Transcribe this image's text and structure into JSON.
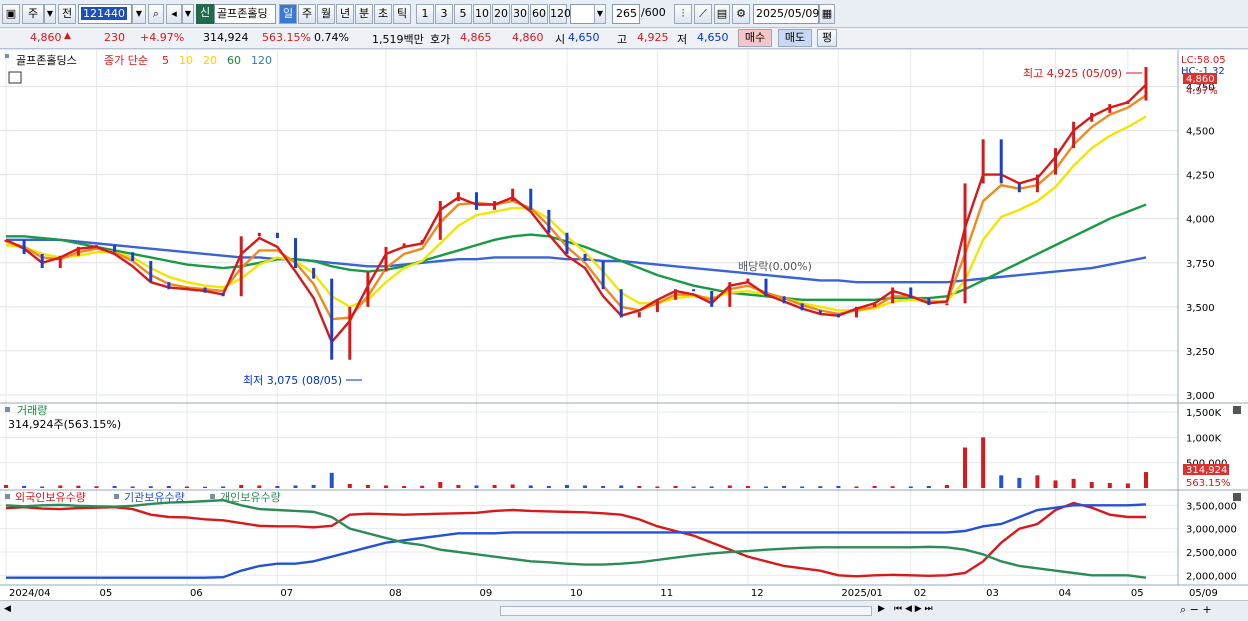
{
  "toolbar": {
    "market_label": "주",
    "prev_label": "전",
    "code": "121440",
    "new_badge": "신",
    "stock_name": "골프존홀딩",
    "periods": [
      "일",
      "주",
      "월",
      "년",
      "분",
      "초",
      "틱"
    ],
    "active_period": "일",
    "intervals": [
      "1",
      "3",
      "5",
      "10",
      "20",
      "30",
      "60",
      "120"
    ],
    "count": "265",
    "count_total": "/600",
    "date": "2025/05/09"
  },
  "quote": {
    "price": "4,860",
    "change": "230",
    "change_pct": "+4.97%",
    "volume": "314,924",
    "volume_ratio": "563.15%",
    "turnover_pct": "0.74%",
    "amount": "1,519백만",
    "bid_label": "호가",
    "bid": "4,865",
    "ask": "4,860",
    "open_label": "시",
    "open": "4,650",
    "high_label": "고",
    "high": "4,925",
    "low_label": "저",
    "low": "4,650",
    "buy_label": "매수",
    "sell_label": "매도",
    "avg_label": "평"
  },
  "legend": {
    "name": "골프존홀딩스",
    "ma_label": "종가 단순",
    "ma_periods": [
      {
        "label": "5",
        "color": "#d7191c"
      },
      {
        "label": "10",
        "color": "#f5d300"
      },
      {
        "label": "20",
        "color": "#f5d300"
      },
      {
        "label": "60",
        "color": "#1a8a3a"
      },
      {
        "label": "120",
        "color": "#2c7fb8"
      }
    ]
  },
  "annotations": {
    "high": "최고 4,925 (05/09)",
    "low": "최저 3,075 (08/05)",
    "dividend": "배당락(0.00%)",
    "lc": "LC:58.05",
    "hc": "HC:-1.32",
    "price_tag": "4,860",
    "pct_tag": "4.97%",
    "vol_tag": "314,924",
    "vol_pct_tag": "563.15%"
  },
  "volume_panel": {
    "title": "거래량",
    "value": "314,924주(563.15%)"
  },
  "holdings_panel": {
    "series": [
      "외국인보유수량",
      "기관보유수량",
      "개인보유수량"
    ]
  },
  "chart_data": {
    "type": "line",
    "title": "",
    "price_axis": {
      "ticks": [
        "4,750",
        "4,500",
        "4,250",
        "4,000",
        "3,750",
        "3,500",
        "3,250",
        "3,000"
      ],
      "ylim": [
        3000,
        4900
      ]
    },
    "volume_axis": {
      "ticks": [
        "1,500K",
        "1,000K",
        "500,000"
      ],
      "ylim": [
        0,
        1600000
      ]
    },
    "holdings_axis": {
      "ticks": [
        "3,500,000",
        "3,000,000",
        "2,500,000",
        "2,000,000"
      ],
      "ylim": [
        1900000,
        3700000
      ]
    },
    "x_labels": [
      "2024/04",
      "05",
      "06",
      "07",
      "08",
      "09",
      "10",
      "11",
      "12",
      "2025/01",
      "02",
      "03",
      "04",
      "05",
      "05/09"
    ],
    "price_close": [
      3880,
      3800,
      3720,
      3790,
      3840,
      3850,
      3810,
      3760,
      3640,
      3600,
      3610,
      3580,
      3560,
      3900,
      3920,
      3890,
      3720,
      3660,
      3200,
      3500,
      3700,
      3840,
      3860,
      3880,
      4100,
      4150,
      4050,
      4100,
      4170,
      4050,
      3920,
      3800,
      3760,
      3600,
      3440,
      3470,
      3540,
      3600,
      3590,
      3500,
      3640,
      3660,
      3560,
      3520,
      3480,
      3460,
      3440,
      3500,
      3520,
      3610,
      3550,
      3510,
      3520,
      4200,
      4450,
      4200,
      4150,
      4250,
      4400,
      4550,
      4600,
      4650,
      4670,
      4860
    ],
    "ma5": [
      3880,
      3830,
      3750,
      3780,
      3830,
      3840,
      3800,
      3730,
      3640,
      3610,
      3600,
      3590,
      3570,
      3800,
      3890,
      3840,
      3700,
      3550,
      3300,
      3420,
      3620,
      3800,
      3840,
      3860,
      4050,
      4120,
      4080,
      4080,
      4120,
      4040,
      3910,
      3790,
      3720,
      3560,
      3450,
      3480,
      3540,
      3590,
      3570,
      3520,
      3620,
      3640,
      3570,
      3530,
      3490,
      3460,
      3450,
      3490,
      3520,
      3590,
      3560,
      3520,
      3530,
      3950,
      4250,
      4250,
      4200,
      4230,
      4350,
      4500,
      4580,
      4630,
      4660,
      4760
    ],
    "ma10": [
      3870,
      3840,
      3780,
      3770,
      3810,
      3830,
      3810,
      3760,
      3680,
      3630,
      3610,
      3600,
      3590,
      3720,
      3820,
      3820,
      3750,
      3630,
      3430,
      3440,
      3560,
      3720,
      3800,
      3830,
      3980,
      4080,
      4090,
      4080,
      4100,
      4060,
      3960,
      3840,
      3750,
      3620,
      3500,
      3480,
      3520,
      3570,
      3570,
      3540,
      3600,
      3620,
      3580,
      3550,
      3510,
      3480,
      3460,
      3480,
      3500,
      3560,
      3560,
      3530,
      3530,
      3800,
      4100,
      4190,
      4170,
      4190,
      4280,
      4420,
      4520,
      4590,
      4630,
      4700
    ],
    "ma20": [
      3850,
      3840,
      3800,
      3780,
      3790,
      3810,
      3810,
      3780,
      3720,
      3670,
      3640,
      3620,
      3610,
      3660,
      3740,
      3780,
      3760,
      3690,
      3560,
      3500,
      3540,
      3640,
      3720,
      3760,
      3860,
      3960,
      4020,
      4040,
      4060,
      4060,
      4000,
      3900,
      3810,
      3700,
      3580,
      3520,
      3520,
      3550,
      3560,
      3550,
      3580,
      3590,
      3570,
      3550,
      3520,
      3500,
      3480,
      3480,
      3490,
      3530,
      3540,
      3530,
      3530,
      3650,
      3880,
      4010,
      4050,
      4100,
      4180,
      4300,
      4400,
      4470,
      4520,
      4580
    ],
    "ma60": [
      3900,
      3900,
      3890,
      3880,
      3860,
      3840,
      3820,
      3800,
      3780,
      3760,
      3740,
      3730,
      3720,
      3730,
      3750,
      3770,
      3770,
      3760,
      3730,
      3710,
      3700,
      3710,
      3730,
      3760,
      3790,
      3820,
      3850,
      3880,
      3900,
      3910,
      3900,
      3870,
      3840,
      3800,
      3760,
      3720,
      3680,
      3650,
      3620,
      3600,
      3580,
      3570,
      3560,
      3550,
      3540,
      3540,
      3540,
      3540,
      3540,
      3550,
      3550,
      3550,
      3560,
      3600,
      3650,
      3700,
      3750,
      3800,
      3850,
      3900,
      3950,
      4000,
      4040,
      4080
    ],
    "ma120": [
      3880,
      3880,
      3880,
      3880,
      3870,
      3860,
      3850,
      3840,
      3830,
      3820,
      3810,
      3800,
      3790,
      3780,
      3780,
      3770,
      3770,
      3760,
      3750,
      3740,
      3730,
      3730,
      3740,
      3750,
      3760,
      3770,
      3770,
      3780,
      3780,
      3780,
      3780,
      3770,
      3770,
      3760,
      3760,
      3750,
      3740,
      3730,
      3720,
      3710,
      3700,
      3690,
      3680,
      3670,
      3660,
      3650,
      3650,
      3640,
      3640,
      3640,
      3640,
      3640,
      3640,
      3650,
      3660,
      3670,
      3680,
      3690,
      3700,
      3710,
      3720,
      3740,
      3760,
      3780
    ],
    "volume": [
      60,
      40,
      30,
      50,
      45,
      35,
      40,
      30,
      35,
      40,
      30,
      25,
      30,
      60,
      50,
      40,
      50,
      60,
      300,
      80,
      60,
      50,
      40,
      45,
      120,
      60,
      50,
      60,
      70,
      50,
      40,
      60,
      50,
      40,
      50,
      40,
      30,
      40,
      30,
      30,
      50,
      40,
      30,
      40,
      30,
      35,
      40,
      30,
      40,
      35,
      30,
      40,
      60,
      800,
      1000,
      250,
      200,
      250,
      150,
      180,
      120,
      100,
      90,
      315
    ],
    "foreign": [
      3440,
      3460,
      3430,
      3420,
      3440,
      3450,
      3460,
      3420,
      3300,
      3250,
      3240,
      3200,
      3180,
      3120,
      3060,
      3050,
      3050,
      3030,
      3060,
      3300,
      3320,
      3310,
      3300,
      3310,
      3320,
      3330,
      3340,
      3380,
      3400,
      3380,
      3370,
      3360,
      3350,
      3330,
      3300,
      3200,
      3050,
      2950,
      2850,
      2700,
      2550,
      2400,
      2300,
      2200,
      2150,
      2100,
      2000,
      1980,
      2000,
      2010,
      2000,
      1990,
      2000,
      2050,
      2300,
      2700,
      3000,
      3100,
      3400,
      3550,
      3450,
      3300,
      3250,
      3250
    ],
    "institution": [
      1950,
      1950,
      1950,
      1950,
      1950,
      1950,
      1950,
      1950,
      1950,
      1950,
      1950,
      1950,
      1960,
      2100,
      2200,
      2250,
      2250,
      2300,
      2400,
      2500,
      2600,
      2700,
      2750,
      2800,
      2850,
      2900,
      2900,
      2900,
      2920,
      2920,
      2920,
      2920,
      2920,
      2920,
      2920,
      2920,
      2920,
      2920,
      2920,
      2920,
      2920,
      2920,
      2920,
      2920,
      2920,
      2920,
      2920,
      2920,
      2920,
      2920,
      2920,
      2920,
      2920,
      2950,
      3050,
      3100,
      3250,
      3400,
      3450,
      3500,
      3500,
      3500,
      3500,
      3520
    ],
    "individual": [
      3500,
      3480,
      3500,
      3510,
      3490,
      3480,
      3470,
      3490,
      3530,
      3560,
      3570,
      3590,
      3610,
      3500,
      3420,
      3400,
      3380,
      3360,
      3250,
      3000,
      2900,
      2800,
      2700,
      2650,
      2550,
      2500,
      2450,
      2400,
      2350,
      2300,
      2280,
      2250,
      2230,
      2230,
      2250,
      2280,
      2330,
      2380,
      2430,
      2470,
      2500,
      2520,
      2550,
      2570,
      2590,
      2600,
      2600,
      2600,
      2600,
      2600,
      2600,
      2610,
      2600,
      2550,
      2450,
      2300,
      2200,
      2150,
      2100,
      2050,
      2000,
      2000,
      2000,
      1950
    ]
  }
}
